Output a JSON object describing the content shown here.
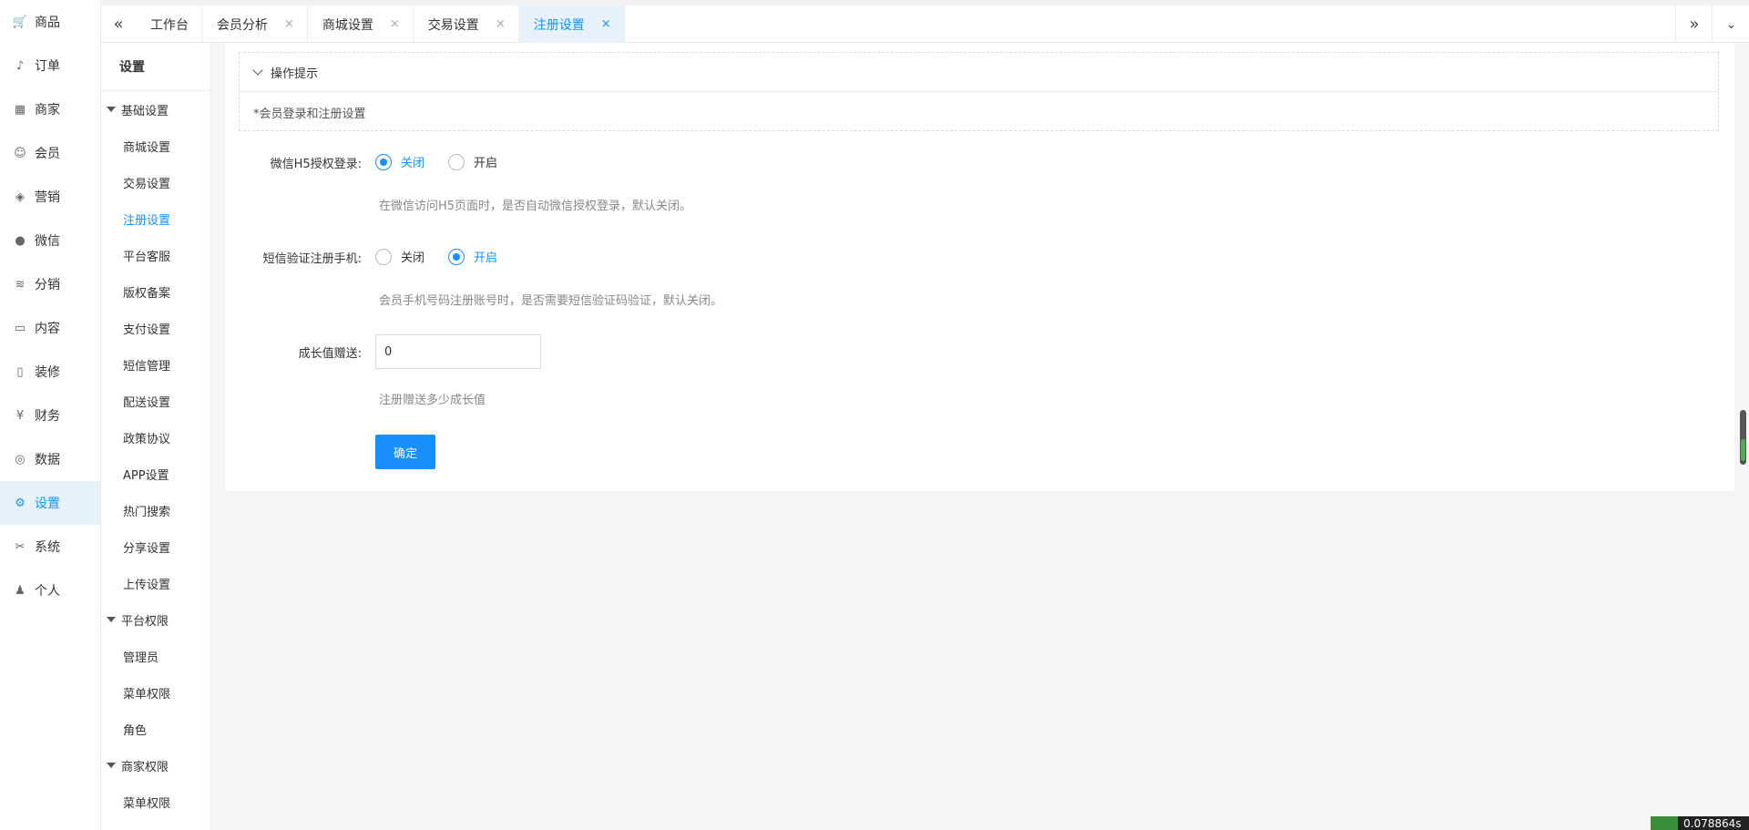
{
  "nav": {
    "items": [
      {
        "label": "商品",
        "icon": "cart-icon"
      },
      {
        "label": "订单",
        "icon": "bell-icon"
      },
      {
        "label": "商家",
        "icon": "store-icon"
      },
      {
        "label": "会员",
        "icon": "user-icon"
      },
      {
        "label": "营销",
        "icon": "box-icon"
      },
      {
        "label": "微信",
        "icon": "wechat-icon"
      },
      {
        "label": "分销",
        "icon": "layers-icon"
      },
      {
        "label": "内容",
        "icon": "book-icon"
      },
      {
        "label": "装修",
        "icon": "phone-icon"
      },
      {
        "label": "财务",
        "icon": "yen-icon"
      },
      {
        "label": "数据",
        "icon": "globe-icon"
      },
      {
        "label": "设置",
        "icon": "gear-icon",
        "active": true
      },
      {
        "label": "系统",
        "icon": "tools-icon"
      },
      {
        "label": "个人",
        "icon": "person-icon"
      }
    ]
  },
  "tabs": {
    "collapse_icon": "double-chevron-left-icon",
    "expand_icon": "double-chevron-right-icon",
    "more_icon": "chevron-down-icon",
    "items": [
      {
        "label": "工作台",
        "closable": false
      },
      {
        "label": "会员分析",
        "closable": true
      },
      {
        "label": "商城设置",
        "closable": true
      },
      {
        "label": "交易设置",
        "closable": true
      },
      {
        "label": "注册设置",
        "closable": true,
        "active": true
      }
    ],
    "close_glyph": "×"
  },
  "submenu": {
    "title": "设置",
    "groups": [
      {
        "label": "基础设置",
        "items": [
          "商城设置",
          "交易设置",
          "注册设置",
          "平台客服",
          "版权备案",
          "支付设置",
          "短信管理",
          "配送设置",
          "政策协议",
          "APP设置",
          "热门搜索",
          "分享设置",
          "上传设置"
        ]
      },
      {
        "label": "平台权限",
        "items": [
          "管理员",
          "菜单权限",
          "角色"
        ]
      },
      {
        "label": "商家权限",
        "items": [
          "菜单权限"
        ]
      }
    ],
    "active_item": "注册设置"
  },
  "tips": {
    "title": "操作提示",
    "text": "*会员登录和注册设置"
  },
  "form": {
    "wechat_h5": {
      "label": "微信H5授权登录:",
      "options": [
        "关闭",
        "开启"
      ],
      "selected": "关闭",
      "hint": "在微信访问H5页面时，是否自动微信授权登录，默认关闭。"
    },
    "sms_verify": {
      "label": "短信验证注册手机:",
      "options": [
        "关闭",
        "开启"
      ],
      "selected": "开启",
      "hint": "会员手机号码注册账号时，是否需要短信验证码验证，默认关闭。"
    },
    "growth": {
      "label": "成长值赠送:",
      "value": "0",
      "hint": "注册赠送多少成长值"
    },
    "submit_label": "确定"
  },
  "debug": {
    "timer": "0.078864s"
  },
  "colors": {
    "accent": "#1890ff",
    "active_bg": "#e8f2fd"
  }
}
